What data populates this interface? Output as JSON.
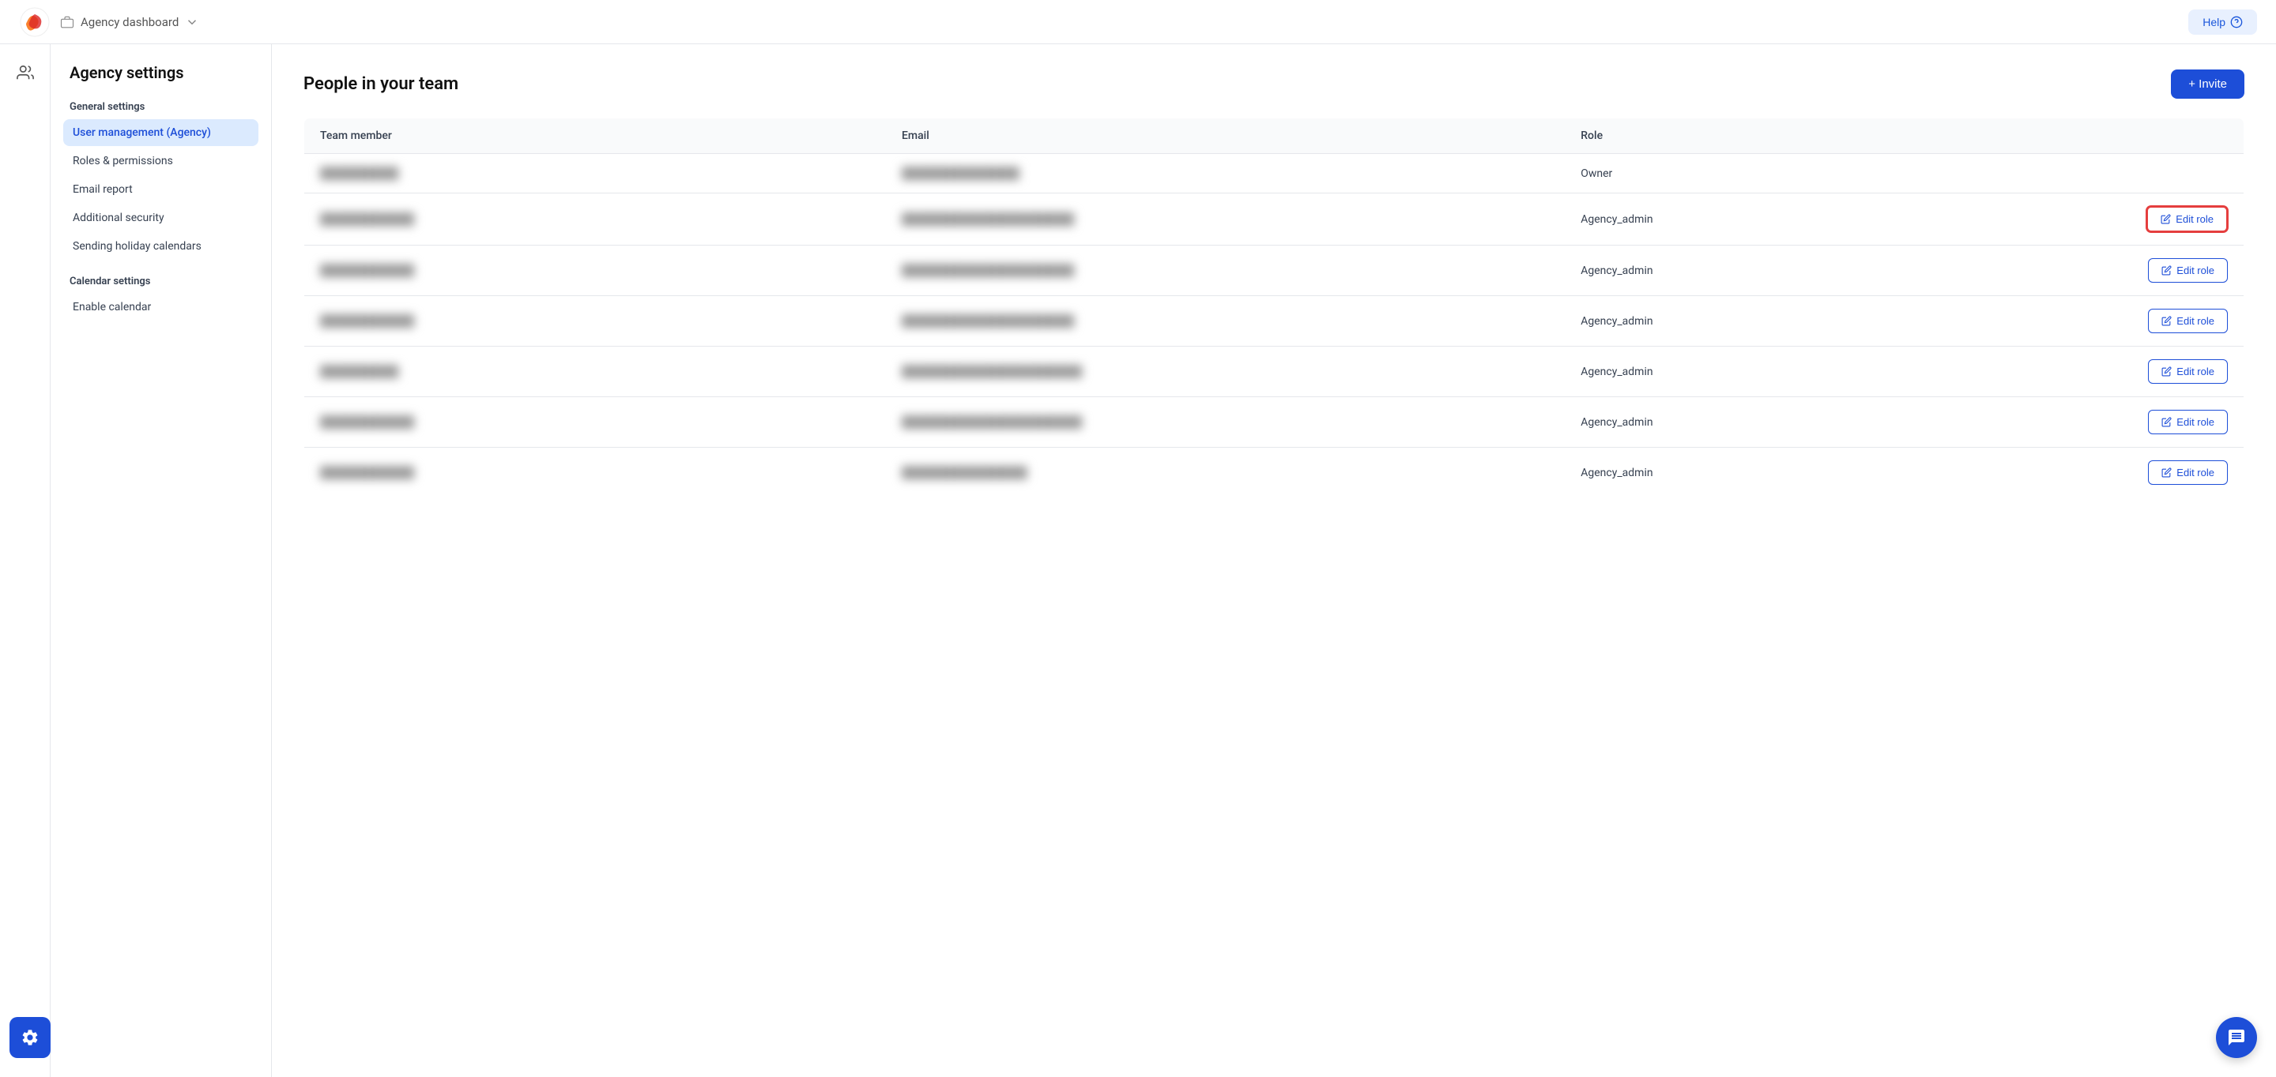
{
  "topnav": {
    "breadcrumb_label": "Agency dashboard",
    "help_label": "Help"
  },
  "settings": {
    "page_title": "Agency settings",
    "sidebar": {
      "general_section_label": "General settings",
      "calendar_section_label": "Calendar settings",
      "items": [
        {
          "id": "user-management",
          "label": "User management (Agency)",
          "active": true
        },
        {
          "id": "roles-permissions",
          "label": "Roles & permissions",
          "active": false
        },
        {
          "id": "email-report",
          "label": "Email report",
          "active": false
        },
        {
          "id": "additional-security",
          "label": "Additional security",
          "active": false
        },
        {
          "id": "sending-holiday",
          "label": "Sending holiday calendars",
          "active": false
        }
      ],
      "calendar_items": [
        {
          "id": "enable-calendar",
          "label": "Enable calendar",
          "active": false
        }
      ]
    }
  },
  "team_table": {
    "title": "People in your team",
    "invite_button": "+ Invite",
    "columns": [
      {
        "id": "member",
        "label": "Team member"
      },
      {
        "id": "email",
        "label": "Email"
      },
      {
        "id": "role",
        "label": "Role"
      }
    ],
    "rows": [
      {
        "member": "██████████",
        "email": "███████████████",
        "role": "Owner",
        "show_edit": false,
        "highlighted": false
      },
      {
        "member": "████████████",
        "email": "██████████████████████",
        "role": "Agency_admin",
        "show_edit": true,
        "highlighted": true
      },
      {
        "member": "████████████",
        "email": "██████████████████████",
        "role": "Agency_admin",
        "show_edit": true,
        "highlighted": false
      },
      {
        "member": "████████████",
        "email": "██████████████████████",
        "role": "Agency_admin",
        "show_edit": true,
        "highlighted": false
      },
      {
        "member": "██████████",
        "email": "███████████████████████",
        "role": "Agency_admin",
        "show_edit": true,
        "highlighted": false
      },
      {
        "member": "████████████",
        "email": "███████████████████████",
        "role": "Agency_admin",
        "show_edit": true,
        "highlighted": false
      },
      {
        "member": "████████████",
        "email": "████████████████",
        "role": "Agency_admin",
        "show_edit": true,
        "highlighted": false
      }
    ],
    "edit_role_label": "Edit role"
  },
  "icons": {
    "pencil": "✎",
    "plus": "+",
    "help_circle": "?",
    "chat": "💬",
    "gear": "⚙",
    "users": "👥",
    "briefcase": "💼",
    "chevron_down": "⌄"
  }
}
